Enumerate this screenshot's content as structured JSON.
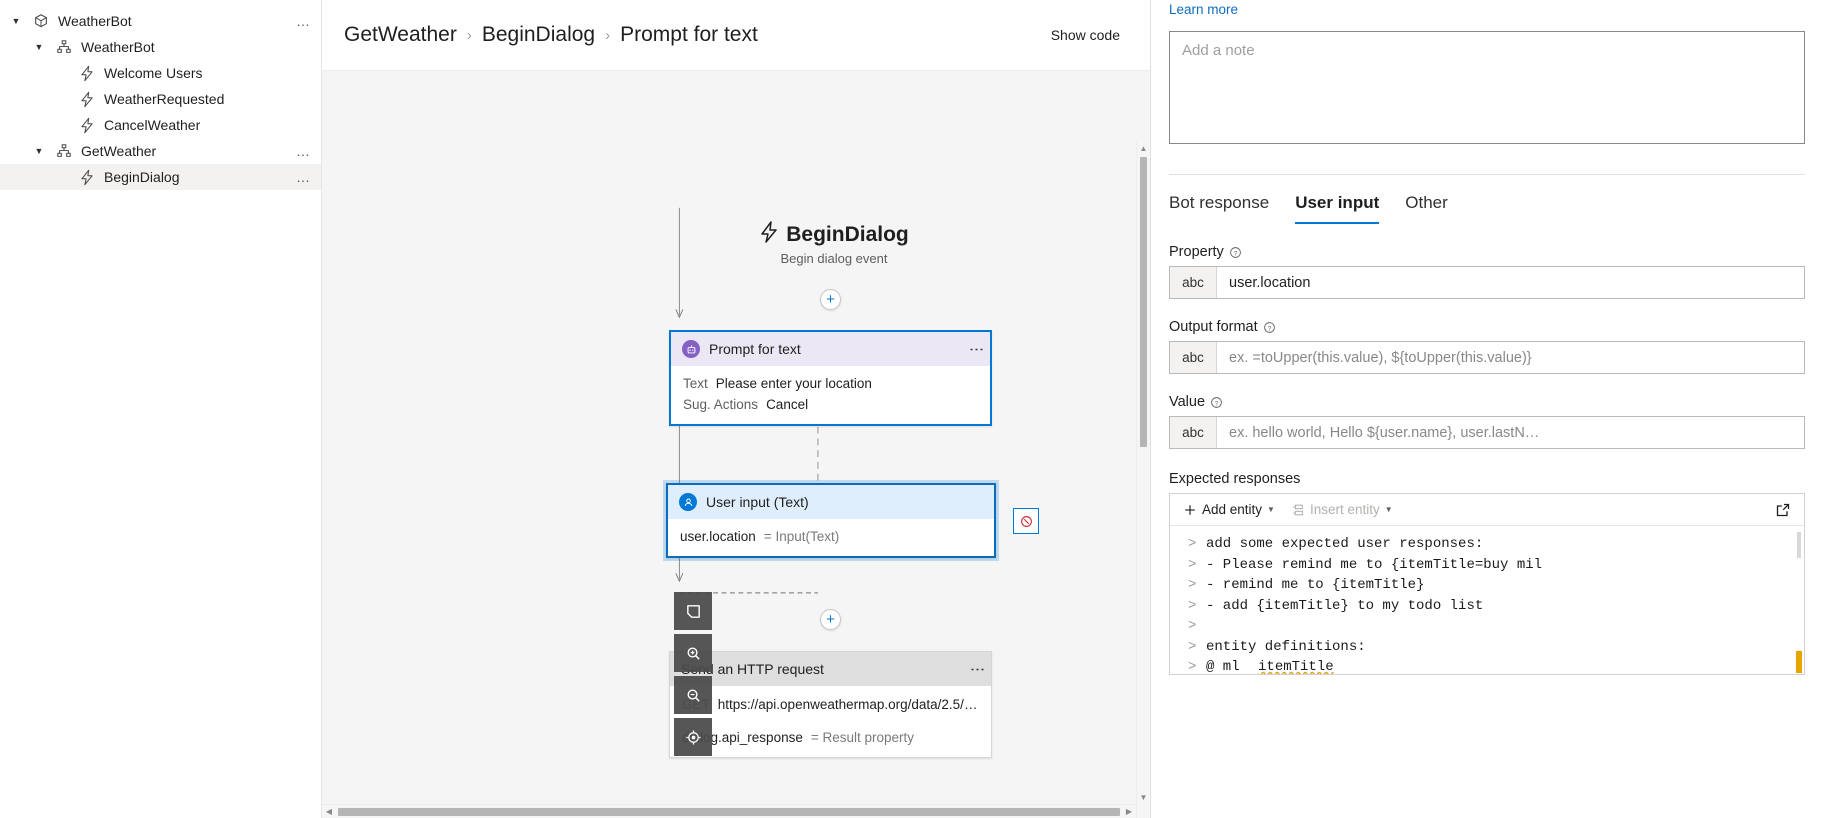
{
  "sidebar": {
    "items": [
      {
        "label": "WeatherBot",
        "icon": "cube-icon",
        "indent": 0,
        "chevron": "down",
        "selected": false,
        "more": true
      },
      {
        "label": "WeatherBot",
        "icon": "sitemap-icon",
        "indent": 1,
        "chevron": "down",
        "selected": false,
        "more": false
      },
      {
        "label": "Welcome Users",
        "icon": "bolt-icon",
        "indent": 2,
        "chevron": "none",
        "selected": false,
        "more": false
      },
      {
        "label": "WeatherRequested",
        "icon": "bolt-icon",
        "indent": 2,
        "chevron": "none",
        "selected": false,
        "more": false
      },
      {
        "label": "CancelWeather",
        "icon": "bolt-icon",
        "indent": 2,
        "chevron": "none",
        "selected": false,
        "more": false
      },
      {
        "label": "GetWeather",
        "icon": "sitemap-icon",
        "indent": 1,
        "chevron": "down",
        "selected": false,
        "more": true
      },
      {
        "label": "BeginDialog",
        "icon": "bolt-icon",
        "indent": 2,
        "chevron": "none",
        "selected": true,
        "more": true
      }
    ]
  },
  "header": {
    "breadcrumb": [
      "GetWeather",
      "BeginDialog",
      "Prompt for text"
    ],
    "separator": "›",
    "show_code_label": "Show code"
  },
  "canvas": {
    "event": {
      "title": "BeginDialog",
      "subtitle": "Begin dialog event",
      "icon": "bolt-icon"
    },
    "nodes": [
      {
        "title": "Prompt for text",
        "icon": "bot-icon",
        "accent": "#8661c5",
        "rows": [
          {
            "key": "Text",
            "value": "Please enter your location",
            "muted": false
          },
          {
            "key": "Sug. Actions",
            "value": "Cancel",
            "muted": false
          }
        ]
      },
      {
        "title": "User input (Text)",
        "icon": "person-icon",
        "accent": "#0078d4",
        "rows": [
          {
            "key": "user.location",
            "value": "= Input(Text)",
            "muted": true
          }
        ]
      },
      {
        "title": "Send an HTTP request",
        "icon": "http-icon",
        "accent": "#8a8a8a",
        "rows": [
          {
            "key": "GET",
            "value": "https://api.openweathermap.org/data/2.5/weat…",
            "muted": false
          },
          {
            "key": "dialog.api_response",
            "value": "= Result property",
            "muted": true
          }
        ]
      }
    ],
    "add_button_label": "+",
    "tools": [
      {
        "name": "fit-to-screen-icon",
        "label": "Fit to screen"
      },
      {
        "name": "zoom-in-icon",
        "label": "Zoom in"
      },
      {
        "name": "zoom-out-icon",
        "label": "Zoom out"
      },
      {
        "name": "reset-zoom-icon",
        "label": "Reset zoom"
      }
    ],
    "error_badge": "error-icon"
  },
  "properties": {
    "learn_more": "Learn more",
    "note_placeholder": "Add a note",
    "tabs": [
      {
        "label": "Bot response",
        "active": false
      },
      {
        "label": "User input",
        "active": true
      },
      {
        "label": "Other",
        "active": false
      }
    ],
    "fields": [
      {
        "label": "Property",
        "has_help": true,
        "prefix": "abc",
        "value": "user.location",
        "placeholder": ""
      },
      {
        "label": "Output format",
        "has_help": true,
        "prefix": "abc",
        "value": "",
        "placeholder": "ex. =toUpper(this.value), ${toUpper(this.value)}"
      },
      {
        "label": "Value",
        "has_help": true,
        "prefix": "abc",
        "value": "",
        "placeholder": "ex. hello world, Hello ${user.name}, user.lastN…"
      }
    ],
    "expected_responses": {
      "label": "Expected responses",
      "add_entity_label": "Add entity",
      "insert_entity_label": "Insert entity",
      "popout_icon": "open-in-new-icon",
      "code_lines": [
        {
          "gutter": ">",
          "text": "add some expected user responses:",
          "squiggle": ""
        },
        {
          "gutter": ">",
          "text": "- Please remind me to {itemTitle=buy mil",
          "squiggle": ""
        },
        {
          "gutter": ">",
          "text": "- remind me to {itemTitle}",
          "squiggle": ""
        },
        {
          "gutter": ">",
          "text": "- add {itemTitle} to my todo list",
          "squiggle": ""
        },
        {
          "gutter": ">",
          "text": "",
          "squiggle": ""
        },
        {
          "gutter": ">",
          "text": "entity definitions:",
          "squiggle": ""
        },
        {
          "gutter": ">",
          "text": "@ ml ",
          "squiggle": "itemTitle"
        }
      ]
    }
  },
  "colors": {
    "accent": "#0078d4",
    "prompt_accent": "#8661c5",
    "link": "#0f6cbd",
    "canvas_bg": "#f5f5f5"
  }
}
